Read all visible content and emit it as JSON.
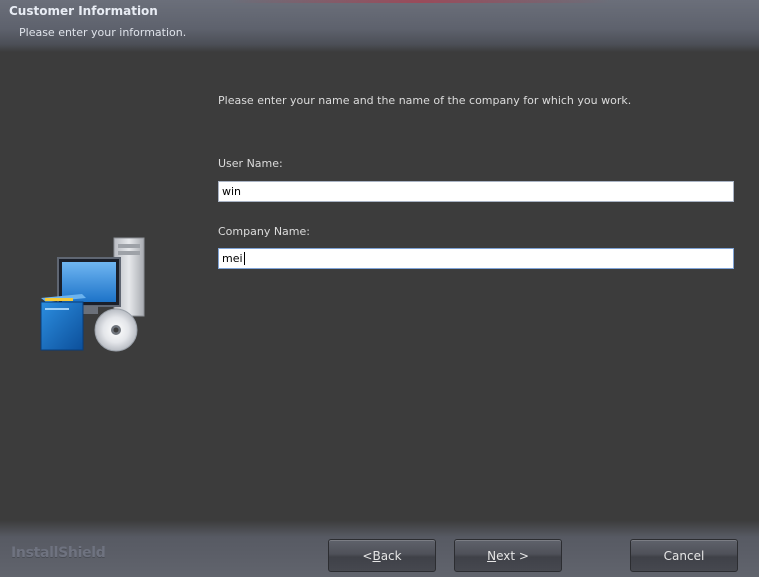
{
  "header": {
    "title": "Customer Information",
    "subtitle": "Please enter your information."
  },
  "illustration": {
    "icon_name": "computer-with-cd-icon"
  },
  "content": {
    "intro": "Please enter your name and the name of the company for which you work.",
    "user_name": {
      "label": "User Name:",
      "value": "win"
    },
    "company_name": {
      "label": "Company Name:",
      "value": "mei"
    }
  },
  "footer": {
    "brand": "InstallShield",
    "back": {
      "prefix": "< ",
      "mnemonic": "B",
      "rest": "ack"
    },
    "next": {
      "mnemonic": "N",
      "rest": "ext >"
    },
    "cancel": "Cancel"
  },
  "colors": {
    "background": "#3c3c3c",
    "header": "#5e626d",
    "text": "#dcdcdc"
  }
}
